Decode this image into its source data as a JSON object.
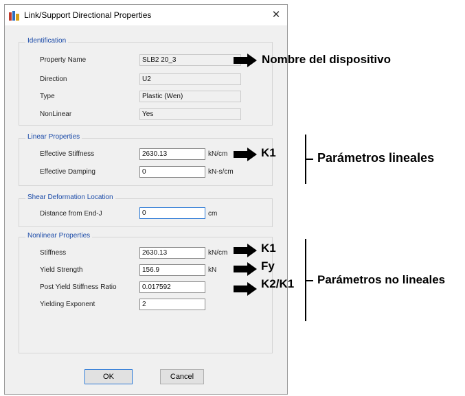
{
  "dialog": {
    "title": "Link/Support Directional Properties",
    "close_glyph": "✕"
  },
  "identification": {
    "label": "Identification",
    "property_name_label": "Property Name",
    "property_name_value": "SLB2 20_3",
    "direction_label": "Direction",
    "direction_value": "U2",
    "type_label": "Type",
    "type_value": "Plastic (Wen)",
    "nonlinear_label": "NonLinear",
    "nonlinear_value": "Yes"
  },
  "linear": {
    "label": "Linear Properties",
    "stiffness_label": "Effective Stiffness",
    "stiffness_value": "2630.13",
    "stiffness_unit": "kN/cm",
    "damping_label": "Effective Damping",
    "damping_value": "0",
    "damping_unit": "kN-s/cm"
  },
  "shear": {
    "label": "Shear Deformation Location",
    "distance_label": "Distance from End-J",
    "distance_value": "0",
    "distance_unit": "cm"
  },
  "nonlinear": {
    "label": "Nonlinear Properties",
    "stiffness_label": "Stiffness",
    "stiffness_value": "2630.13",
    "stiffness_unit": "kN/cm",
    "yield_label": "Yield Strength",
    "yield_value": "156.9",
    "yield_unit": "kN",
    "post_yield_label": "Post Yield Stiffness Ratio",
    "post_yield_value": "0.017592",
    "exponent_label": "Yielding Exponent",
    "exponent_value": "2"
  },
  "buttons": {
    "ok": "OK",
    "cancel": "Cancel"
  },
  "annotations": {
    "device_name": "Nombre del dispositivo",
    "k1_linear": "K1",
    "linear_params": "Parámetros lineales",
    "k1_nonlinear": "K1",
    "fy": "Fy",
    "k2k1": "K2/K1",
    "nonlinear_params": "Parámetros no lineales"
  },
  "colors": {
    "group_label": "#1a4aa8",
    "dialog_bg": "#f0f0f0",
    "focus_border": "#2b79d6"
  }
}
